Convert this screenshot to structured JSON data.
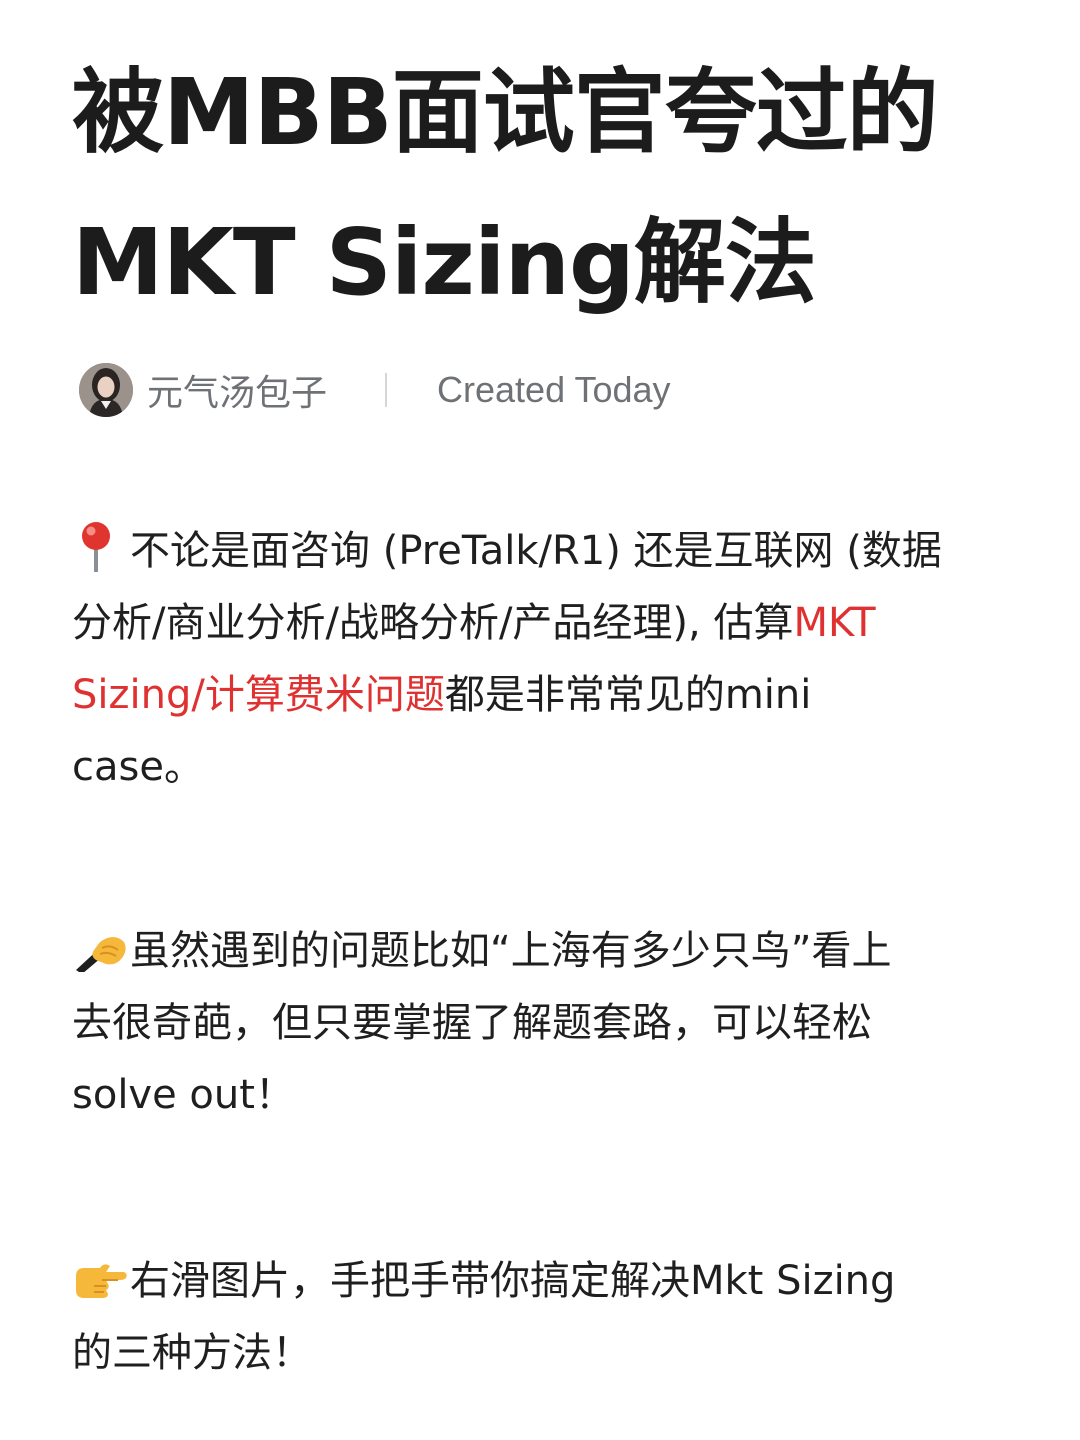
{
  "title": {
    "line1": "被MBB面试官夸过的",
    "line2": "MKT Sizing解法"
  },
  "meta": {
    "author": "元气汤包子",
    "created": "Created Today"
  },
  "icons": {
    "p1": "round-pushpin-icon",
    "p2": "writing-hand-icon",
    "p3": "pointing-right-icon"
  },
  "colors": {
    "highlight": "#e03131",
    "text": "#1f1f1f",
    "meta": "#6e7276"
  },
  "paragraphs": {
    "p1": {
      "l1": "不论是面咨询 (PreTalk/R1) 还是互联网 (数据",
      "l2a": "分析/商业分析/战略分析/产品经理), 估算",
      "l2b": "MKT",
      "l3a": "Sizing/计算费米问题",
      "l3b": "都是非常常见的mini",
      "l4": "case。"
    },
    "p2": {
      "l1": "虽然遇到的问题比如“上海有多少只鸟”看上",
      "l2": "去很奇葩，但只要掌握了解题套路，可以轻松",
      "l3": "solve out！"
    },
    "p3": {
      "l1": "右滑图片，手把手带你搞定解决Mkt Sizing",
      "l2": "的三种方法！"
    }
  }
}
